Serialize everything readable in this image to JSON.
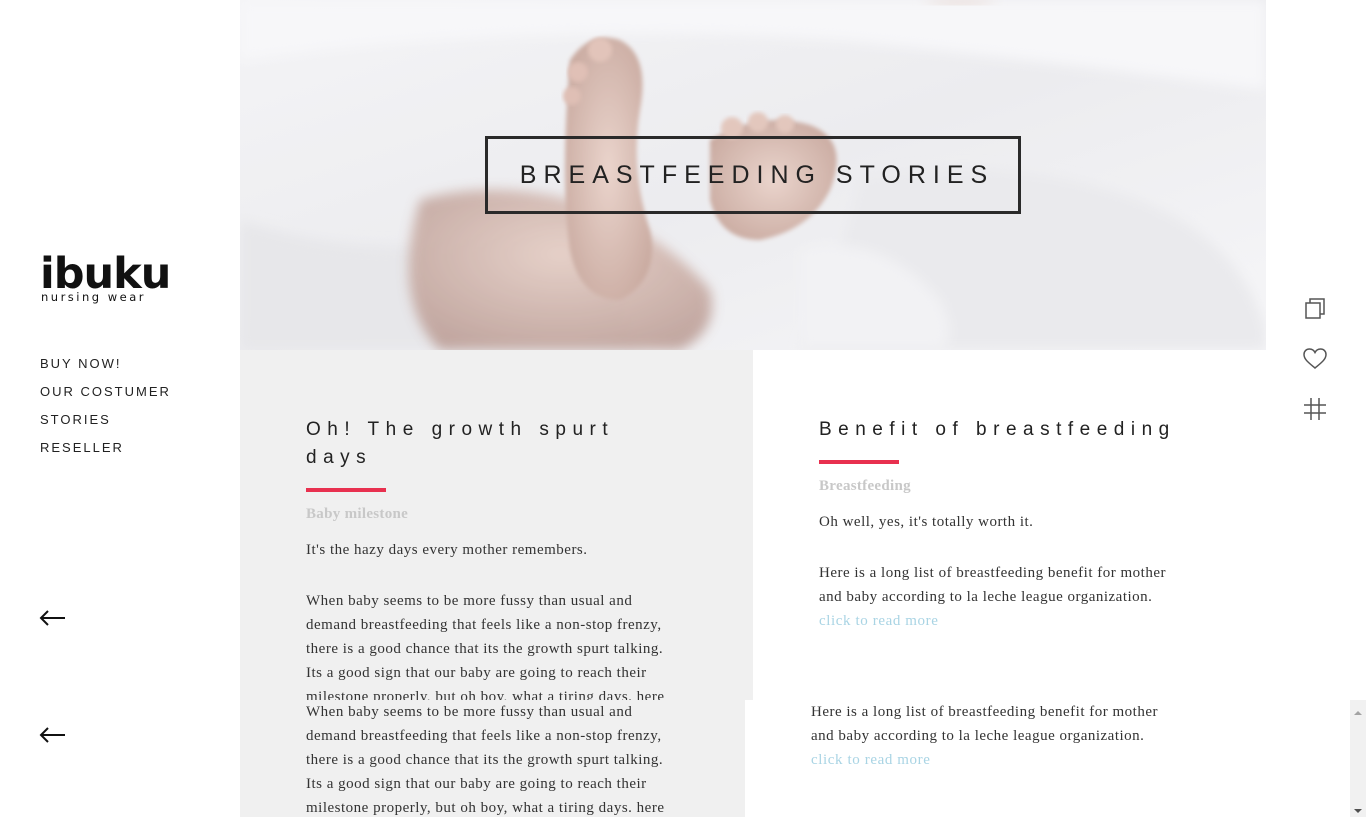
{
  "logo": {
    "main": "ibuku",
    "sub": "nursing wear"
  },
  "nav": {
    "items": [
      {
        "label": "BUY NOW!"
      },
      {
        "label": "OUR COSTUMER"
      },
      {
        "label": "STORIES"
      },
      {
        "label": "RESELLER"
      }
    ]
  },
  "hero": {
    "title": "BREASTFEEDING STORIES"
  },
  "cards": [
    {
      "title": "Oh! The growth spurt days",
      "tag": "Baby milestone",
      "intro": "It's the hazy days every mother remembers.",
      "body_lines": [
        "When baby seems to be more fussy than usual and",
        "demand breastfeeding that feels like a non-stop frenzy,",
        "there is a good chance that its the growth spurt talking.",
        "Its a good sign that our baby are going to reach their",
        "milestone properly, but oh boy, what a tiring days. here"
      ]
    },
    {
      "title": "Benefit of breastfeeding",
      "tag": "Breastfeeding",
      "intro": "Oh well, yes, it's totally worth it.",
      "body_lines": [
        "Here is a long list of breastfeeding benefit for mother",
        "and baby according to la leche league organization."
      ],
      "link": "click to read more"
    }
  ],
  "duplicate": {
    "left_lines": [
      "When baby seems to be more fussy than usual and",
      "demand breastfeeding that feels like a non-stop frenzy,",
      "there is a good chance that its the growth spurt talking.",
      "Its a good sign that our baby are going to reach their",
      "milestone properly, but oh boy, what a tiring days. here"
    ],
    "right_lines": [
      "Here is a long list of breastfeeding benefit for mother",
      "and baby according to la leche league organization."
    ],
    "right_link": "click to read more"
  },
  "icons": {
    "back_arrow_1": "arrow-left-icon",
    "back_arrow_2": "arrow-left-icon",
    "copy": "copy-icon",
    "heart": "heart-icon",
    "grid": "grid-icon"
  },
  "colors": {
    "accent": "#e8304f",
    "link": "#a9d4e4",
    "panel_gray": "#f0f0f0",
    "tag": "#c8c8c8"
  }
}
